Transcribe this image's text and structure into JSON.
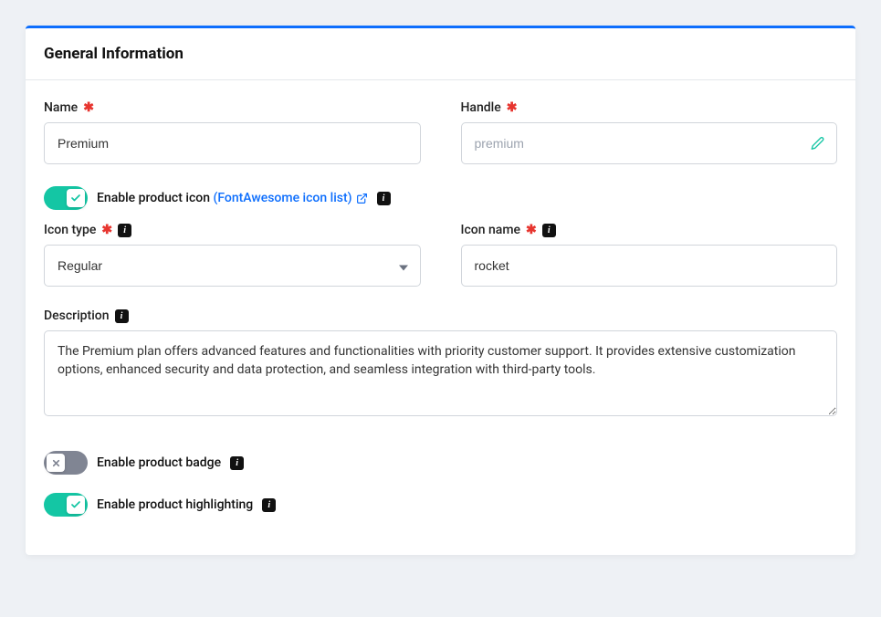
{
  "header": {
    "title": "General Information"
  },
  "labels": {
    "name": "Name",
    "handle": "Handle",
    "enable_icon": "Enable product icon",
    "fontawesome_link": "(FontAwesome icon list)",
    "icon_type": "Icon type",
    "icon_name": "Icon name",
    "description": "Description",
    "enable_badge": "Enable product badge",
    "enable_highlight": "Enable product highlighting"
  },
  "values": {
    "name": "Premium",
    "handle_placeholder": "premium",
    "icon_type": "Regular",
    "icon_name": "rocket",
    "description": "The Premium plan offers advanced features and functionalities with priority customer support. It provides extensive customization options, enhanced security and data protection, and seamless integration with third-party tools."
  },
  "toggles": {
    "enable_icon": true,
    "enable_badge": false,
    "enable_highlight": true
  }
}
